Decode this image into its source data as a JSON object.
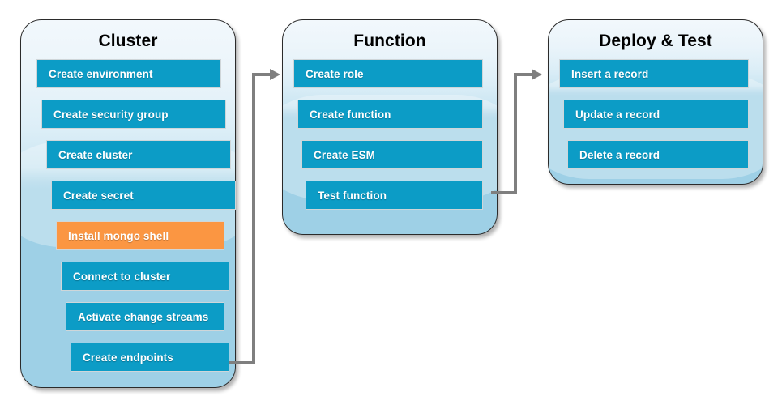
{
  "diagram": {
    "title": "Cluster / Function / Deploy & Test workflow",
    "colors": {
      "step_blue": "#0C9CC6",
      "step_highlight_orange": "#FB9642",
      "group_fill_bottom": "#9ED0E6",
      "group_fill_top": "#F2F8FC",
      "connector_gray": "#7F7F7F",
      "group_border": "#2B2B2B",
      "step_text": "#FFFFFF",
      "title_text": "#000000"
    },
    "groups": [
      {
        "id": "cluster",
        "title": "Cluster",
        "steps": [
          {
            "label": "Create environment",
            "state": "normal"
          },
          {
            "label": "Create security group",
            "state": "normal"
          },
          {
            "label": "Create cluster",
            "state": "normal"
          },
          {
            "label": "Create secret",
            "state": "normal"
          },
          {
            "label": "Install mongo shell",
            "state": "highlight"
          },
          {
            "label": "Connect to cluster",
            "state": "normal"
          },
          {
            "label": "Activate change streams",
            "state": "normal"
          },
          {
            "label": "Create endpoints",
            "state": "normal"
          }
        ]
      },
      {
        "id": "function",
        "title": "Function",
        "steps": [
          {
            "label": "Create role",
            "state": "normal"
          },
          {
            "label": "Create function",
            "state": "normal"
          },
          {
            "label": "Create ESM",
            "state": "normal"
          },
          {
            "label": "Test function",
            "state": "normal"
          }
        ]
      },
      {
        "id": "deploy-test",
        "title": "Deploy & Test",
        "steps": [
          {
            "label": "Insert a record",
            "state": "normal"
          },
          {
            "label": "Update a record",
            "state": "normal"
          },
          {
            "label": "Delete a record",
            "state": "normal"
          }
        ]
      }
    ],
    "connectors": [
      {
        "id": "cluster-to-function",
        "from": "Create endpoints",
        "to": "Create role"
      },
      {
        "id": "function-to-deploy",
        "from": "Test function",
        "to": "Insert a record"
      }
    ]
  }
}
